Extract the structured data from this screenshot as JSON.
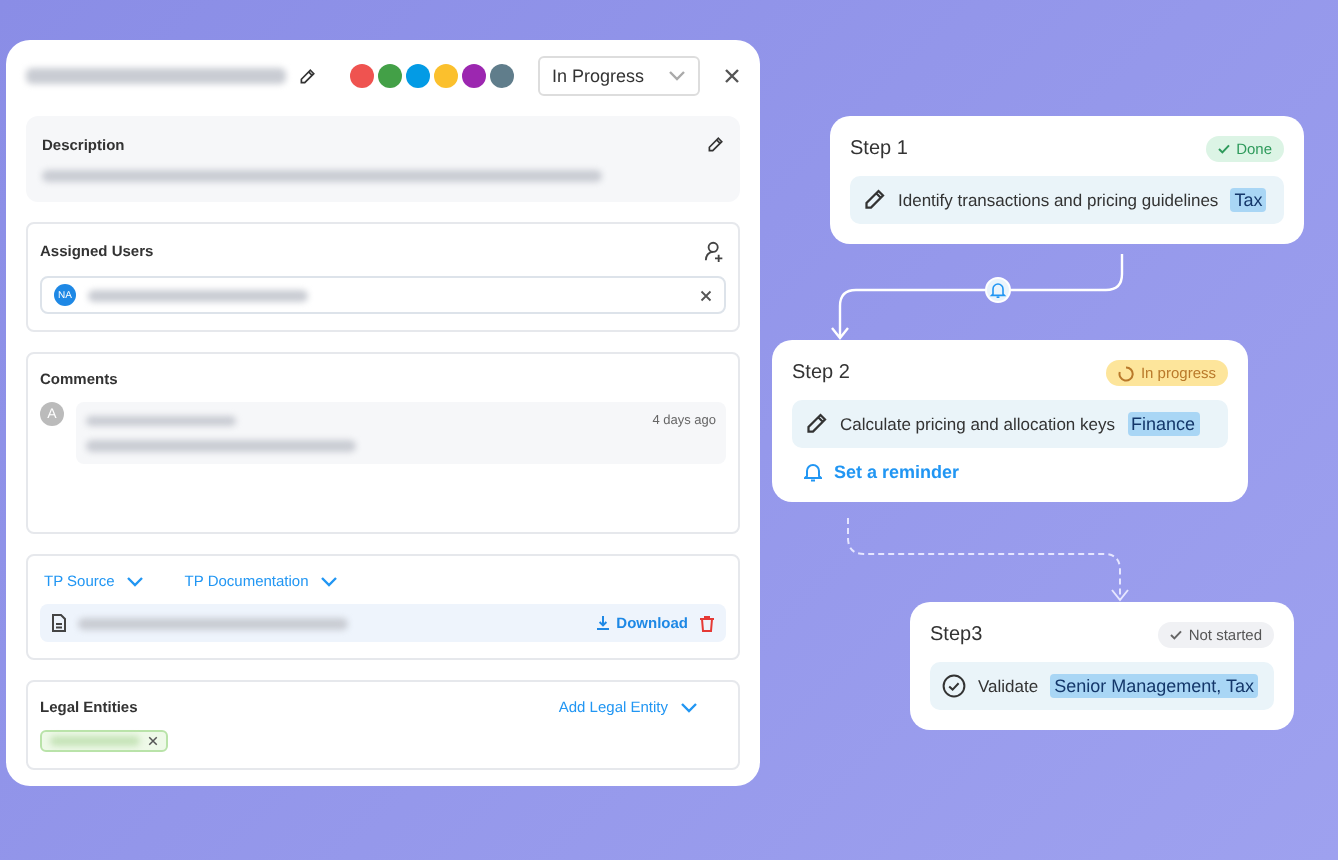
{
  "task_panel": {
    "colors": [
      {
        "color": "#ef5350"
      },
      {
        "color": "#43a047"
      },
      {
        "color": "#039be5"
      },
      {
        "color": "#fbc02d"
      },
      {
        "color": "#9c27b0"
      },
      {
        "color": "#607d8b"
      }
    ],
    "status": "In Progress",
    "description": {
      "heading": "Description"
    },
    "assigned_users": {
      "heading": "Assigned Users",
      "users": [
        {
          "initials": "NA"
        }
      ]
    },
    "comments": {
      "heading": "Comments",
      "items": [
        {
          "avatar": "A",
          "time": "4 days ago"
        }
      ]
    },
    "documents": {
      "tabs": [
        "TP Source",
        "TP Documentation"
      ],
      "files": [
        {
          "action": "Download"
        }
      ]
    },
    "legal_entities": {
      "heading": "Legal Entities",
      "add_label": "Add Legal Entity"
    }
  },
  "steps": [
    {
      "title": "Step 1",
      "status": {
        "kind": "done",
        "label": "Done"
      },
      "task": {
        "kind": "pencil",
        "text": "Identify transactions and pricing guidelines",
        "tag": "Tax"
      }
    },
    {
      "title": "Step 2",
      "status": {
        "kind": "in_progress",
        "label": "In progress"
      },
      "task": {
        "kind": "pencil",
        "text": "Calculate pricing and allocation keys",
        "tag": "Finance"
      },
      "reminder": "Set a reminder"
    },
    {
      "title": "Step3",
      "status": {
        "kind": "not_started",
        "label": "Not started"
      },
      "task": {
        "kind": "check",
        "text": "Validate",
        "tag": "Senior Management, Tax"
      }
    }
  ]
}
